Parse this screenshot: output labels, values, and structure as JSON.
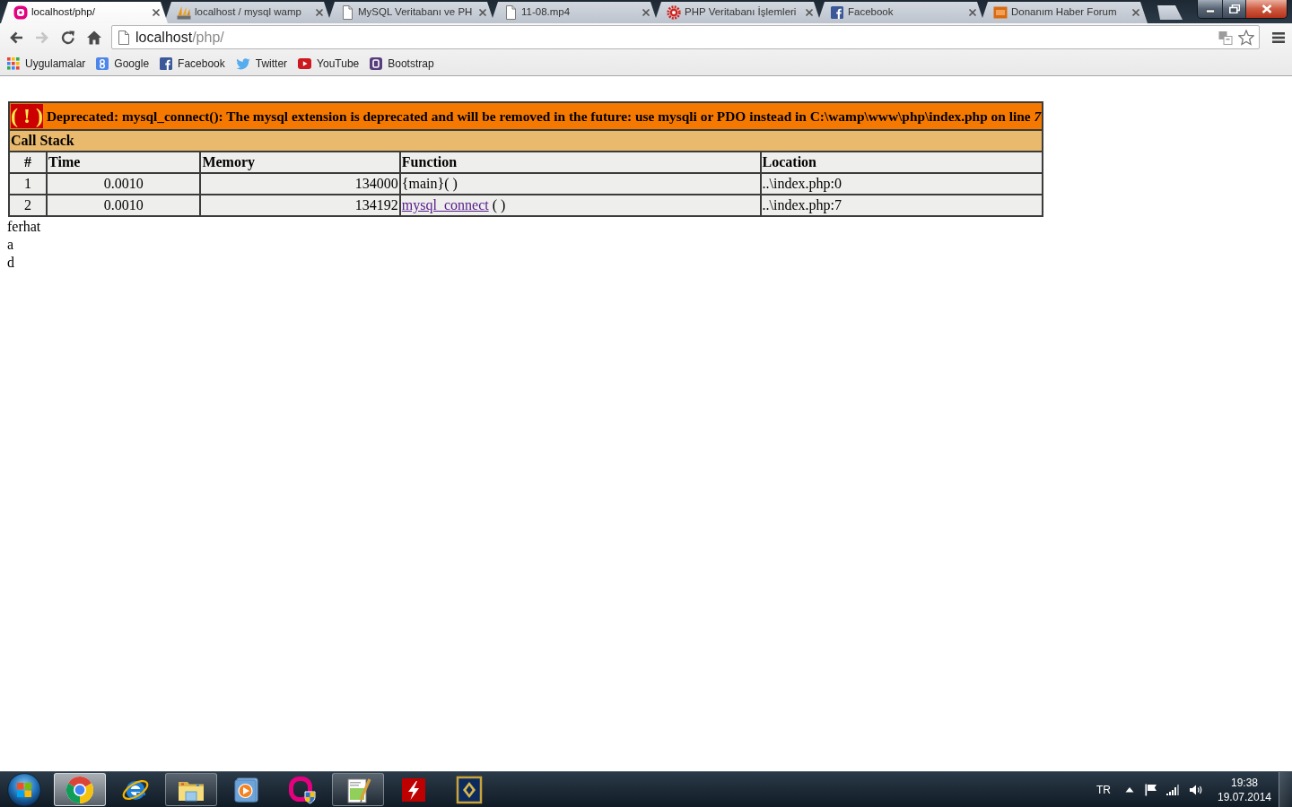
{
  "window": {
    "tabs": [
      {
        "title": "localhost/php/",
        "selected": true
      },
      {
        "title": "localhost / mysql wamp",
        "selected": false
      },
      {
        "title": "MySQL Veritabanı ve PH",
        "selected": false
      },
      {
        "title": "11-08.mp4",
        "selected": false
      },
      {
        "title": "PHP Veritabanı İşlemleri",
        "selected": false
      },
      {
        "title": "Facebook",
        "selected": false
      },
      {
        "title": "Donanım Haber Forum",
        "selected": false
      }
    ]
  },
  "toolbar": {
    "nav_buttons": [
      {
        "kind": "back",
        "disabled": false
      },
      {
        "kind": "forward",
        "disabled": true
      },
      {
        "kind": "reload",
        "disabled": false
      },
      {
        "kind": "home",
        "disabled": false
      }
    ],
    "address_bar": {
      "host": "localhost",
      "path": "/php/"
    }
  },
  "bookmarks": [
    {
      "label": "Uygulamalar"
    },
    {
      "label": "Google"
    },
    {
      "label": "Facebook"
    },
    {
      "label": "Twitter"
    },
    {
      "label": "YouTube"
    },
    {
      "label": "Bootstrap"
    }
  ],
  "page": {
    "error_table": {
      "warning": "( ! )",
      "message": "Deprecated: mysql_connect(): The mysql extension is deprecated and will be removed in the future: use mysqli or PDO instead in C:\\wamp\\www\\php\\index.php on line *7*",
      "call_stack_title": "Call Stack",
      "columns": [
        "#",
        "Time",
        "Memory",
        "Function",
        "Location"
      ],
      "rows": [
        {
          "number": "1",
          "time": "0.0010",
          "memory": "134000",
          "function": {
            "name": "{main}",
            "args": "( )",
            "linked": false
          },
          "location": "..\\index.php:0"
        },
        {
          "number": "2",
          "time": "0.0010",
          "memory": "134192",
          "function": {
            "name": "mysql_connect",
            "args": "( )",
            "linked": true
          },
          "location": "..\\index.php:7"
        }
      ]
    },
    "output_lines": [
      "ferhat",
      "a",
      "d"
    ]
  },
  "taskbar": {
    "apps": [
      {
        "open": true,
        "selected": true
      },
      {
        "open": false,
        "selected": false
      },
      {
        "open": true,
        "selected": false
      },
      {
        "open": false,
        "selected": false
      },
      {
        "open": false,
        "selected": false
      },
      {
        "open": true,
        "selected": false
      },
      {
        "open": false,
        "selected": false
      },
      {
        "open": false,
        "selected": false
      }
    ],
    "tray": {
      "language": "TR",
      "time": "19:38",
      "date": "19.07.2014"
    }
  }
}
